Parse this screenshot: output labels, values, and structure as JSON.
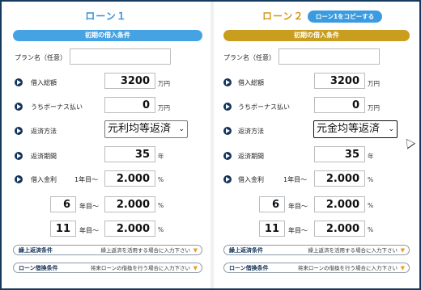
{
  "loan1": {
    "title": "ローン１",
    "section_bar": "初期の借入条件",
    "plan_label": "プラン名（任意）",
    "plan_value": "",
    "total_label": "借入総額",
    "total_value": "3200",
    "total_unit": "万円",
    "bonus_label": "うちボーナス払い",
    "bonus_value": "0",
    "bonus_unit": "万円",
    "method_label": "返済方法",
    "method_value": "元利均等返済",
    "period_label": "返済期間",
    "period_value": "35",
    "period_unit": "年",
    "rate_label": "借入金利",
    "rate_year1_label": "1年目～",
    "rate1_value": "2.000",
    "rate_unit": "%",
    "rate2_year": "6",
    "rate2_year_suffix": "年目～",
    "rate2_value": "2.000",
    "rate3_year": "11",
    "rate3_year_suffix": "年目～",
    "rate3_value": "2.000",
    "prepay_title": "繰上返済条件",
    "prepay_desc": "繰上返済を活用する場合に入力下さい",
    "refi_title": "ローン借換条件",
    "refi_desc": "将来ローンの借換を行う場合に入力下さい"
  },
  "loan2": {
    "title": "ローン２",
    "copy_button": "ローン1をコピーする",
    "section_bar": "初期の借入条件",
    "plan_label": "プラン名（任意）",
    "plan_value": "",
    "total_label": "借入総額",
    "total_value": "3200",
    "total_unit": "万円",
    "bonus_label": "うちボーナス払い",
    "bonus_value": "0",
    "bonus_unit": "万円",
    "method_label": "返済方法",
    "method_value": "元金均等返済",
    "period_label": "返済期間",
    "period_value": "35",
    "period_unit": "年",
    "rate_label": "借入金利",
    "rate_year1_label": "1年目～",
    "rate1_value": "2.000",
    "rate_unit": "%",
    "rate2_year": "6",
    "rate2_year_suffix": "年目～",
    "rate2_value": "2.000",
    "rate3_year": "11",
    "rate3_year_suffix": "年目～",
    "rate3_value": "2.000",
    "prepay_title": "繰上返済条件",
    "prepay_desc": "繰上返済を活用する場合に入力下さい",
    "refi_title": "ローン借換条件",
    "refi_desc": "将来ローンの借換を行う場合に入力下さい"
  },
  "icons": {
    "row_bullet": "circle-arrow-right-icon",
    "collapse_caret": "caret-down-icon",
    "select_chevron": "chevron-down-icon"
  },
  "colors": {
    "loan1_accent": "#45a3e3",
    "loan2_accent": "#c99d1e",
    "bullet": "#14345a",
    "caret": "#e6a020"
  }
}
